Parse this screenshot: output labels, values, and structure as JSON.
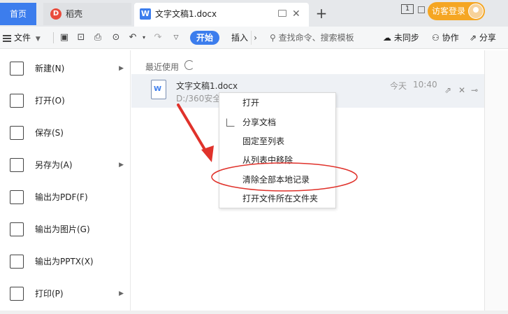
{
  "titlebar": {
    "home_tab": "首页",
    "daoke_tab": "稻壳",
    "doc_tab": "文字文稿1.docx",
    "badge": "1",
    "login_label": "访客登录"
  },
  "toolbar": {
    "file_menu": "文件",
    "start_tab": "开始",
    "insert_tab": "插入",
    "more": "›",
    "search_placeholder": "查找命令、搜索模板",
    "sync": "未同步",
    "collab": "协作",
    "share": "分享"
  },
  "file_menu": {
    "items": [
      {
        "label": "新建(N)",
        "submenu": true
      },
      {
        "label": "打开(O)",
        "submenu": false
      },
      {
        "label": "保存(S)",
        "submenu": false
      },
      {
        "label": "另存为(A)",
        "submenu": true
      },
      {
        "label": "输出为PDF(F)",
        "submenu": false
      },
      {
        "label": "输出为图片(G)",
        "submenu": false
      },
      {
        "label": "输出为PPTX(X)",
        "submenu": false
      },
      {
        "label": "打印(P)",
        "submenu": true
      }
    ]
  },
  "recent": {
    "title": "最近使用",
    "file": {
      "name": "文字文稿1.docx",
      "path": "D:/360安全",
      "date": "今天",
      "time": "10:40"
    }
  },
  "context_menu": {
    "items": [
      "打开",
      "分享文档",
      "固定至列表",
      "从列表中移除",
      "清除全部本地记录",
      "打开文件所在文件夹"
    ]
  },
  "colors": {
    "accent": "#3c7ded",
    "login": "#f5a623",
    "annotation": "#e0322b"
  }
}
